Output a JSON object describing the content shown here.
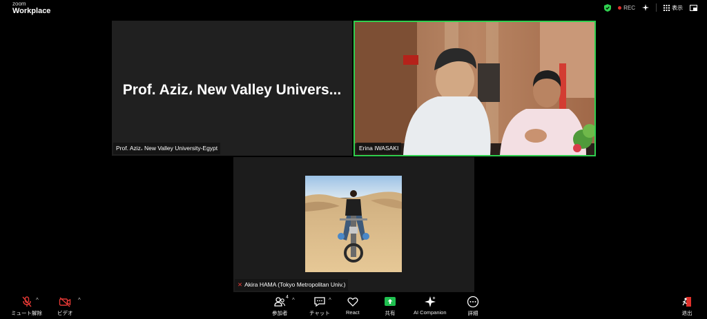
{
  "app": {
    "brand_small": "zoom",
    "brand_big": "Workplace"
  },
  "header": {
    "rec": "REC",
    "view": "表示"
  },
  "tiles": {
    "prof": {
      "display_name": "Prof. Aziz، New Valley Univers...",
      "label": "Prof. Aziz، New Valley University-Egypt"
    },
    "erina": {
      "label": "Erina IWASAKI"
    },
    "akira": {
      "label": "Akira HAMA (Tokyo Metropolitan Univ.)"
    }
  },
  "toolbar": {
    "mute": "ミュート解除",
    "video": "ビデオ",
    "participants": "参加者",
    "participants_count": "4",
    "chat": "チャット",
    "react": "React",
    "share": "共有",
    "ai": "AI Companion",
    "more": "詳細",
    "leave": "退出"
  },
  "colors": {
    "active_speaker": "#2fd04f",
    "share": "#1fbf4f",
    "leave": "#e0312b",
    "muted": "#e53935"
  }
}
